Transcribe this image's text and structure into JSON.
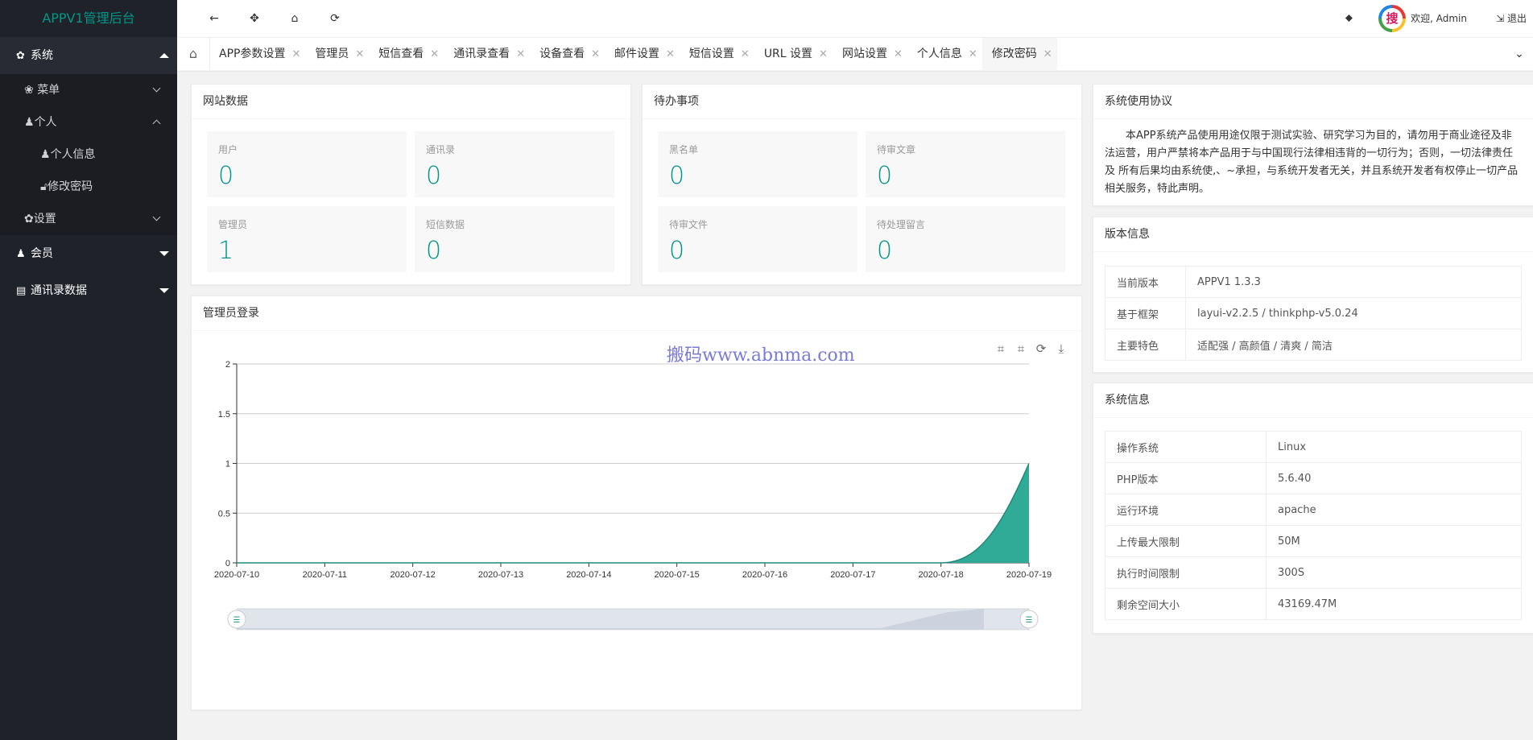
{
  "app": {
    "title": "APPV1管理后台"
  },
  "sidebar": {
    "system": {
      "icon": "gear-icon",
      "label": "系统"
    },
    "menu": {
      "icon": "paw-icon",
      "label": "菜单"
    },
    "personal": {
      "icon": "user-icon",
      "label": "个人"
    },
    "personal_info": {
      "icon": "user-icon",
      "label": "个人信息"
    },
    "change_password": {
      "icon": "lock-icon",
      "label": "修改密码"
    },
    "settings": {
      "icon": "gear-icon",
      "label": "设置"
    },
    "members": {
      "icon": "users-icon",
      "label": "会员"
    },
    "contacts_data": {
      "icon": "id-card-icon",
      "label": "通讯录数据"
    }
  },
  "header": {
    "welcome": "欢迎, Admin",
    "logout": "退出"
  },
  "tabs": [
    {
      "label": "APP参数设置"
    },
    {
      "label": "管理员"
    },
    {
      "label": "短信查看"
    },
    {
      "label": "通讯录查看"
    },
    {
      "label": "设备查看"
    },
    {
      "label": "邮件设置"
    },
    {
      "label": "短信设置"
    },
    {
      "label": "URL 设置"
    },
    {
      "label": "网站设置"
    },
    {
      "label": "个人信息"
    },
    {
      "label": "修改密码",
      "active": true
    }
  ],
  "site_data": {
    "title": "网站数据",
    "stats": [
      {
        "label": "用户",
        "value": "0"
      },
      {
        "label": "通讯录",
        "value": "0"
      },
      {
        "label": "管理员",
        "value": "1"
      },
      {
        "label": "短信数据",
        "value": "0"
      }
    ]
  },
  "todo": {
    "title": "待办事项",
    "stats": [
      {
        "label": "黑名单",
        "value": "0"
      },
      {
        "label": "待审文章",
        "value": "0"
      },
      {
        "label": "待审文件",
        "value": "0"
      },
      {
        "label": "待处理留言",
        "value": "0"
      }
    ]
  },
  "agreement": {
    "title": "系统使用协议",
    "text": "本APP系统产品使用用途仅限于测试实验、研究学习为目的，请勿用于商业途径及非法运营，用户严禁将本产品用于与中国现行法律相违背的一切行为；否则，一切法律责任 及 所有后果均由系统使,、~承担，与系统开发者无关，并且系统开发者有权停止一切产品相关服务，特此声明。"
  },
  "version": {
    "title": "版本信息",
    "rows": [
      {
        "k": "当前版本",
        "v": "APPV1 1.3.3"
      },
      {
        "k": "基于框架",
        "v": "layui-v2.2.5 / thinkphp-v5.0.24"
      },
      {
        "k": "主要特色",
        "v": "适配强 / 高颜值 / 清爽 / 简洁"
      }
    ]
  },
  "sysinfo": {
    "title": "系统信息",
    "rows": [
      {
        "k": "操作系统",
        "v": "Linux"
      },
      {
        "k": "PHP版本",
        "v": "5.6.40"
      },
      {
        "k": "运行环境",
        "v": "apache"
      },
      {
        "k": "上传最大限制",
        "v": "50M"
      },
      {
        "k": "执行时间限制",
        "v": "300S"
      },
      {
        "k": "剩余空间大小",
        "v": "43169.47M"
      }
    ]
  },
  "login_chart": {
    "title": "管理员登录",
    "watermark": "搬码www.abnma.com",
    "toolbox": [
      "zoom-icon",
      "zoom-reset-icon",
      "refresh-icon",
      "download-icon"
    ]
  },
  "chart_data": {
    "type": "area",
    "x": [
      "2020-07-10",
      "2020-07-11",
      "2020-07-12",
      "2020-07-13",
      "2020-07-14",
      "2020-07-15",
      "2020-07-16",
      "2020-07-17",
      "2020-07-18",
      "2020-07-19"
    ],
    "values": [
      0,
      0,
      0,
      0,
      0,
      0,
      0,
      0,
      0,
      1
    ],
    "ylim": [
      0,
      2
    ],
    "yticks": [
      "0",
      "0.5",
      "1",
      "1.5",
      "2"
    ],
    "grid": true,
    "color": "#2fab97"
  },
  "colors": {
    "accent": "#009688",
    "sidebar_bg": "#20222a"
  }
}
